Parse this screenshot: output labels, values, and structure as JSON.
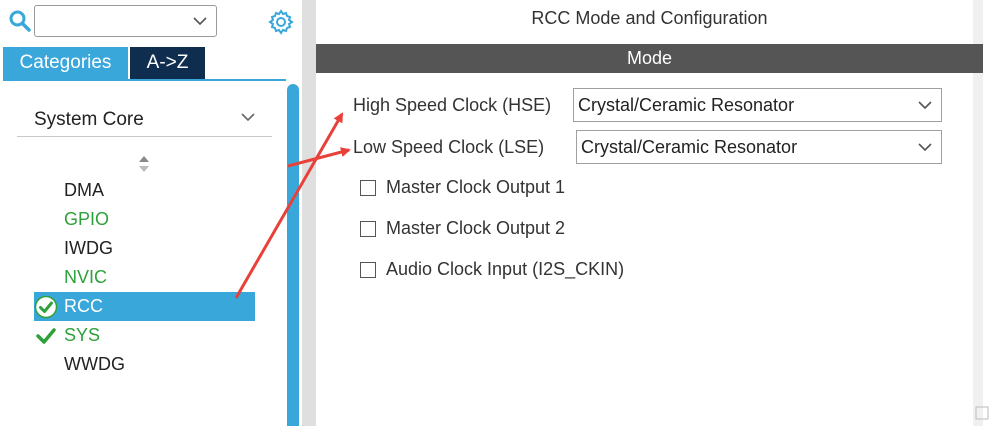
{
  "search": {
    "value": "",
    "placeholder": ""
  },
  "tabs": [
    {
      "label": "Categories",
      "active": true
    },
    {
      "label": "A->Z",
      "active": false
    }
  ],
  "category": {
    "label": "System Core"
  },
  "items": [
    {
      "label": "DMA",
      "state": "default"
    },
    {
      "label": "GPIO",
      "state": "enabled"
    },
    {
      "label": "IWDG",
      "state": "default"
    },
    {
      "label": "NVIC",
      "state": "enabled"
    },
    {
      "label": "RCC",
      "state": "selected"
    },
    {
      "label": "SYS",
      "state": "enabled"
    },
    {
      "label": "WWDG",
      "state": "default"
    }
  ],
  "right": {
    "title": "RCC Mode and Configuration",
    "mode_header": "Mode",
    "hse": {
      "label": "High Speed Clock (HSE)",
      "value": "Crystal/Ceramic Resonator"
    },
    "lse": {
      "label": "Low Speed Clock (LSE)",
      "value": "Crystal/Ceramic Resonator"
    },
    "checkboxes": [
      {
        "label": "Master Clock Output 1",
        "checked": false
      },
      {
        "label": "Master Clock Output 2",
        "checked": false
      },
      {
        "label": "Audio Clock Input (I2S_CKIN)",
        "checked": false
      }
    ]
  },
  "colors": {
    "accent": "#3aa7db",
    "dark_tab": "#0e2d4f",
    "enabled_text": "#2ea13a",
    "mode_header_bg": "#555555",
    "annotation_arrow": "#e8413a"
  },
  "icons": [
    "search-icon",
    "chevron-down-icon",
    "gear-icon",
    "sort-icon",
    "check-circle-icon",
    "check-icon",
    "resize-grip-icon"
  ]
}
